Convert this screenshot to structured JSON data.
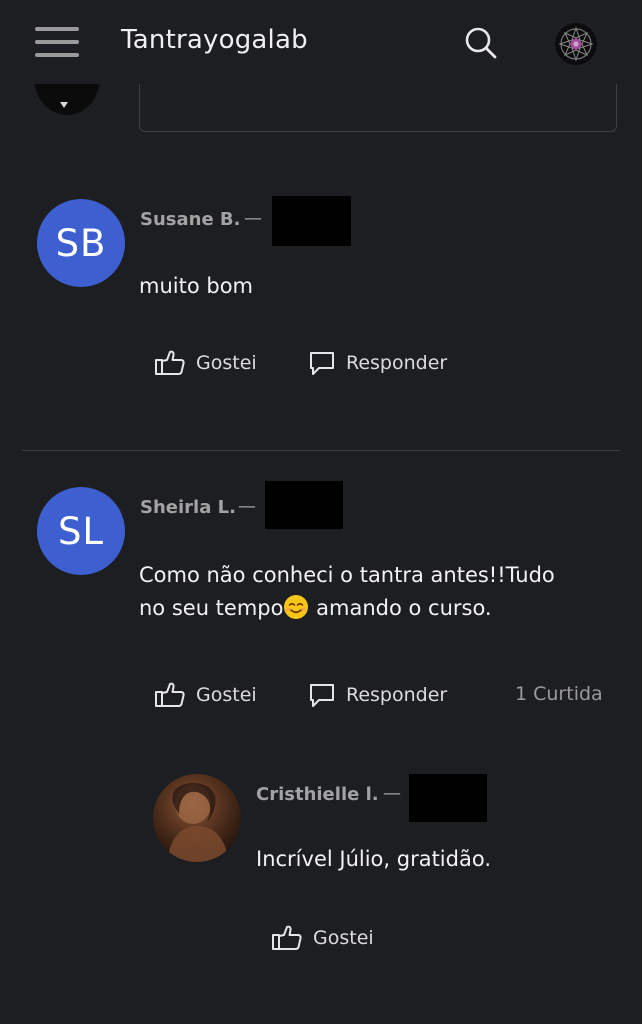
{
  "header": {
    "app_title": "Tantrayogalab"
  },
  "comments": [
    {
      "initials": "SB",
      "author": "Susane B.",
      "dash": "—",
      "text": "muito bom",
      "like_label": "Gostei",
      "reply_label": "Responder"
    },
    {
      "initials": "SL",
      "author": "Sheirla L.",
      "dash": "—",
      "text_line1": "Como não conheci o tantra antes!!Tudo",
      "text_line2_before": "no seu tempo",
      "text_line2_after": " amando o curso.",
      "like_label": "Gostei",
      "reply_label": "Responder",
      "likes": "1 Curtida"
    }
  ],
  "reply": {
    "author": "Cristhielle l.",
    "dash": "—",
    "text": "Incrível Júlio, gratidão.",
    "like_label": "Gostei"
  },
  "icons": {
    "menu": "hamburger-icon",
    "search": "search-icon",
    "logo": "mandala-logo",
    "like": "thumbs-up-icon",
    "reply": "speech-bubble-icon",
    "emoji": "smiling-face-emoji"
  },
  "colors": {
    "background": "#1d1e22",
    "avatar_blue": "#3d5fcf",
    "muted_text": "#a3a3a3",
    "emoji_yellow": "#f7c518"
  }
}
